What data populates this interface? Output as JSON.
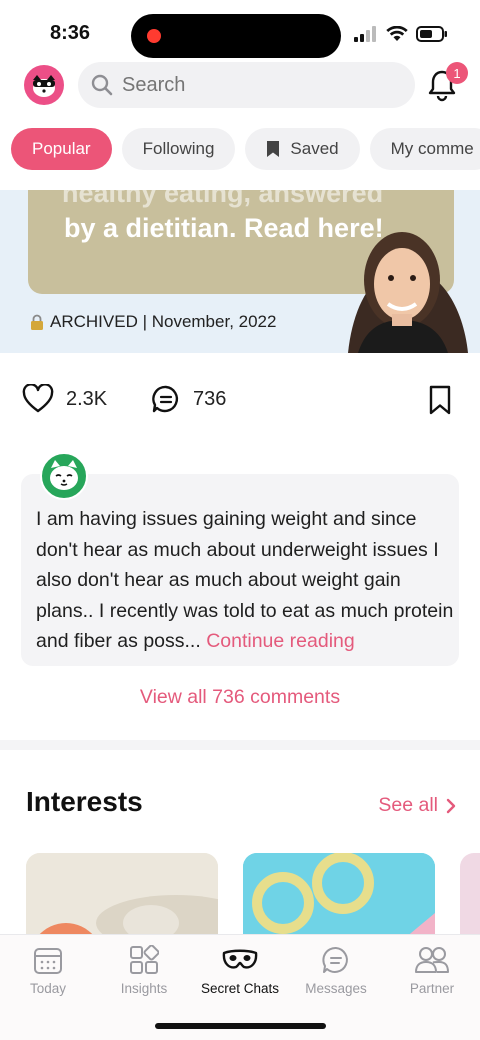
{
  "status": {
    "time": "8:36"
  },
  "header": {
    "search_placeholder": "Search",
    "notification_count": "1"
  },
  "tabs": [
    {
      "label": "Popular",
      "active": true
    },
    {
      "label": "Following",
      "active": false
    },
    {
      "label": "Saved",
      "active": false
    },
    {
      "label": "My comme",
      "active": false
    }
  ],
  "post": {
    "banner_text_partial": "healthy eating, answered",
    "banner_text": "by a dietitian. Read here!",
    "archived_label": "ARCHIVED | November, 2022",
    "likes": "2.3K",
    "comments": "736"
  },
  "top_comment": {
    "text": "I am having issues gaining weight and since don't hear as much about underweight issues I also don't hear as much about weight gain plans.. I recently was told to eat as much protein and fiber as poss...",
    "continue_label": "Continue reading"
  },
  "view_all_label": "View all 736 comments",
  "interests": {
    "title": "Interests",
    "see_all": "See all"
  },
  "bottom_nav": [
    {
      "label": "Today",
      "icon": "calendar-icon"
    },
    {
      "label": "Insights",
      "icon": "grid-icon"
    },
    {
      "label": "Secret Chats",
      "icon": "mask-icon",
      "active": true
    },
    {
      "label": "Messages",
      "icon": "chat-icon"
    },
    {
      "label": "Partner",
      "icon": "people-icon"
    }
  ],
  "colors": {
    "accent": "#ec5578",
    "link": "#e45a7c",
    "avatar_green": "#27a65a"
  }
}
